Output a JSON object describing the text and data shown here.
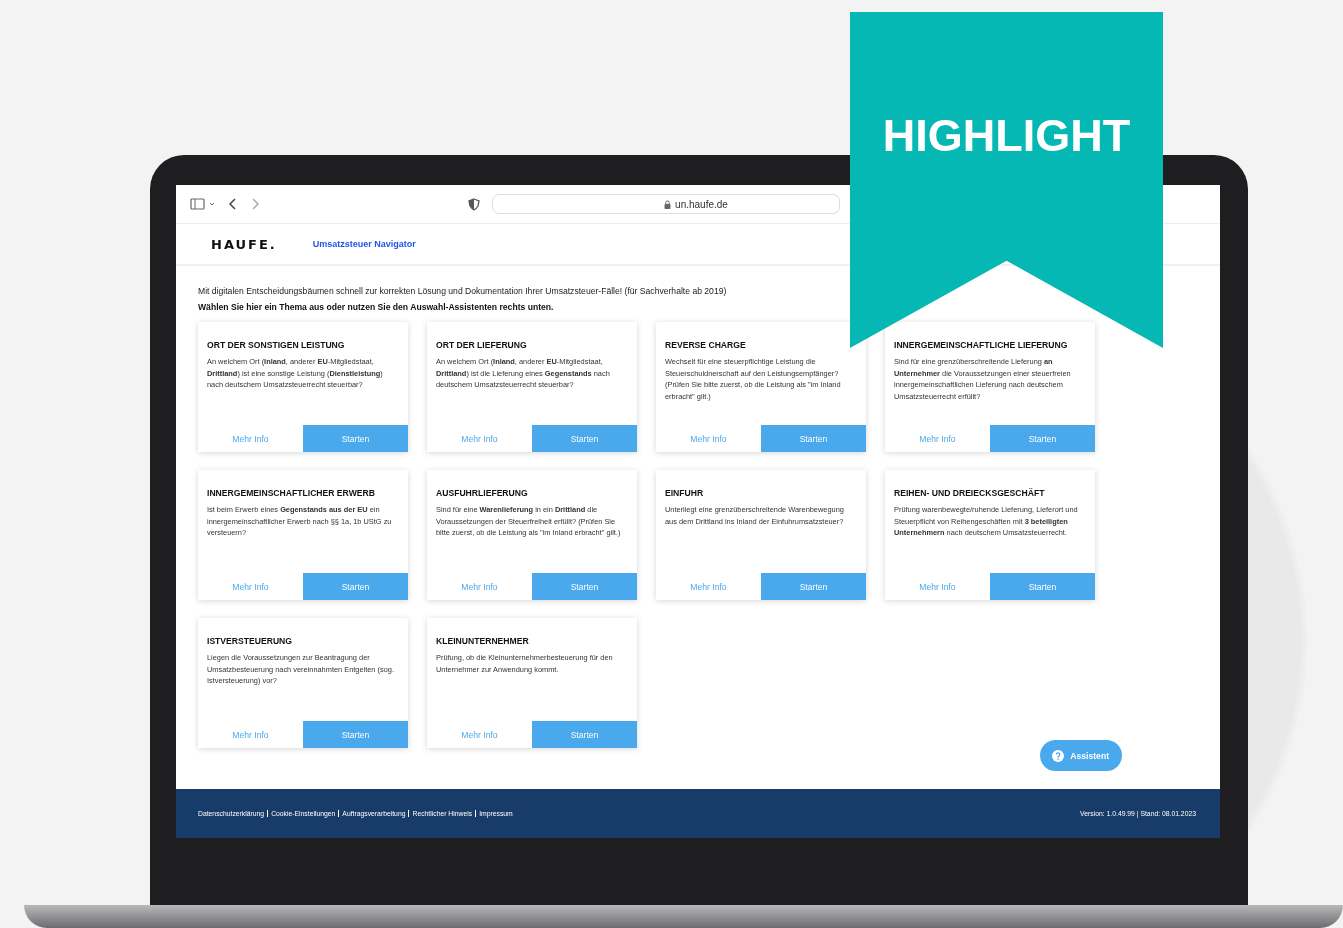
{
  "browser": {
    "url": "un.haufe.de"
  },
  "header": {
    "logo": "HAUFE.",
    "app_title": "Umsatzsteuer Navigator"
  },
  "intro": {
    "text": "Mit digitalen Entscheidungsbäumen schnell zur korrekten Lösung und Dokumentation Ihrer Umsatzsteuer-Fälle! (für Sachverhalte ab 2019)",
    "instruction": "Wählen Sie hier ein Thema aus oder nutzen Sie den Auswahl-Assistenten rechts unten."
  },
  "topics": [
    {
      "title": "ORT DER SONSTIGEN LEISTUNG",
      "description": "An welchem Ort (**Inland**, anderer **EU**-Mitgliedstaat, **Drittland**) ist eine sonstige Leistung (**Dienstleistung**) nach deutschem Umsatzsteuerrecht steuerbar?",
      "info_label": "Mehr Info",
      "start_label": "Starten"
    },
    {
      "title": "ORT DER LIEFERUNG",
      "description": "An welchem Ort (**Inland**, anderer **EU**-Mitgliedstaat, **Drittland**) ist die Lieferung eines **Gegenstands** nach deutschem Umsatzsteuerrecht steuerbar?",
      "info_label": "Mehr Info",
      "start_label": "Starten"
    },
    {
      "title": "REVERSE CHARGE",
      "description": "Wechselt für eine steuerpflichtige Leistung die Steuerschuldnerschaft auf den Leistungsempfänger? (Prüfen Sie bitte zuerst, ob die Leistung als \"im Inland erbracht\" gilt.)",
      "info_label": "Mehr Info",
      "start_label": "Starten"
    },
    {
      "title": "INNERGEMEINSCHAFTLICHE LIEFERUNG",
      "description": "Sind für eine grenzüberschreitende Lieferung **an Unternehmer** die Voraussetzungen einer steuerfreien innergemeinschaftlichen Lieferung nach deutschem Umsatzsteuerrecht erfüllt?",
      "info_label": "Mehr Info",
      "start_label": "Starten"
    },
    {
      "title": "INNERGEMEINSCHAFTLICHER ERWERB",
      "description": "Ist beim Erwerb eines **Gegenstands aus der EU** ein innergemeinschaftlicher Erwerb nach §§ 1a, 1b UStG zu versteuern?",
      "info_label": "Mehr Info",
      "start_label": "Starten"
    },
    {
      "title": "AUSFUHRLIEFERUNG",
      "description": "Sind für eine **Warenlieferung** in ein **Drittland** die Voraussetzungen der Steuerfreiheit erfüllt? (Prüfen Sie bitte zuerst, ob die Leistung als \"im Inland erbracht\" gilt.)",
      "info_label": "Mehr Info",
      "start_label": "Starten"
    },
    {
      "title": "EINFUHR",
      "description": "Unterliegt eine grenzüberschreitende Warenbewegung aus dem Drittland ins Inland der Einfuhrumsatzsteuer?",
      "info_label": "Mehr Info",
      "start_label": "Starten"
    },
    {
      "title": "REIHEN- UND DREIECKSGESCHÄFT",
      "description": "Prüfung warenbewegte/ruhende Lieferung, Lieferort und Steuerpflicht von Reihengeschäften mit **3 beteiligten Unternehmern** nach deutschem Umsatzsteuerrecht.",
      "info_label": "Mehr Info",
      "start_label": "Starten"
    },
    {
      "title": "ISTVERSTEUERUNG",
      "description": "Liegen die Voraussetzungen zur Beantragung der Umsatzbesteuerung nach vereinnahmten Entgelten (sog. Istversteuerung) vor?",
      "info_label": "Mehr Info",
      "start_label": "Starten"
    },
    {
      "title": "KLEINUNTERNEHMER",
      "description": "Prüfung, ob die Kleinunternehmerbesteuerung für den Unternehmer zur Anwendung kommt.",
      "info_label": "Mehr Info",
      "start_label": "Starten"
    }
  ],
  "assistant_button": "Assistent",
  "footer": {
    "links": [
      "Datenschutzerklärung",
      "Cookie-Einstellungen",
      "Auftragsverarbeitung",
      "Rechtlicher Hinweis",
      "Impressum"
    ],
    "version": "Version: 1.0.49.99 | Stand: 08.01.2023"
  },
  "banner": {
    "label": "HIGHLIGHT"
  }
}
